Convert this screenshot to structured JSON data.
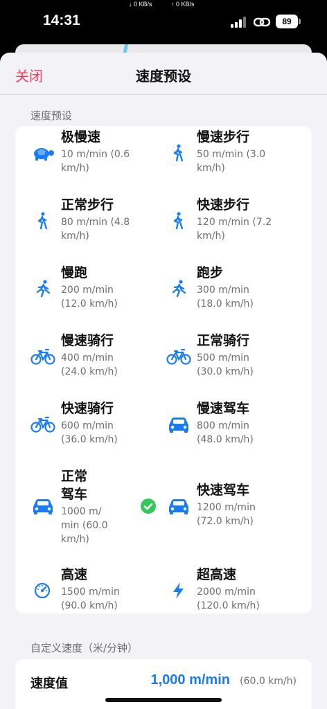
{
  "status": {
    "time": "14:31",
    "net_down": "↓ 0 KB/s",
    "net_up": "↑ 0 KB/s",
    "battery": "89"
  },
  "nav": {
    "close_label": "关闭",
    "title": "速度预设"
  },
  "presets_section": {
    "label": "速度预设",
    "items": [
      {
        "name": "极慢速",
        "line1": "10 m/min (0.6",
        "line2": "km/h)",
        "icon": "turtle-icon"
      },
      {
        "name": "慢速步行",
        "line1": "50 m/min (3.0",
        "line2": "km/h)",
        "icon": "walk-icon"
      },
      {
        "name": "正常步行",
        "line1": "80 m/min (4.8",
        "line2": "km/h)",
        "icon": "walk-icon"
      },
      {
        "name": "快速步行",
        "line1": "120 m/min (7.2",
        "line2": "km/h)",
        "icon": "walk-icon"
      },
      {
        "name": "慢跑",
        "line1": "200 m/min",
        "line2": "(12.0 km/h)",
        "icon": "run-icon"
      },
      {
        "name": "跑步",
        "line1": "300 m/min",
        "line2": "(18.0 km/h)",
        "icon": "run-icon"
      },
      {
        "name": "慢速骑行",
        "line1": "400 m/min",
        "line2": "(24.0 km/h)",
        "icon": "bicycle-icon"
      },
      {
        "name": "正常骑行",
        "line1": "500 m/min",
        "line2": "(30.0 km/h)",
        "icon": "bicycle-icon"
      },
      {
        "name": "快速骑行",
        "line1": "600 m/min",
        "line2": "(36.0 km/h)",
        "icon": "bicycle-icon"
      },
      {
        "name": "慢速驾车",
        "line1": "800 m/min",
        "line2": "(48.0 km/h)",
        "icon": "car-icon"
      },
      {
        "name_l1": "正常",
        "name_l2": "驾车",
        "line1": "1000 m/",
        "line2": "min (60.0",
        "line3": "km/h)",
        "icon": "car-icon",
        "selected": true
      },
      {
        "name": "快速驾车",
        "line1": "1200 m/min",
        "line2": "(72.0 km/h)",
        "icon": "car-icon"
      },
      {
        "name": "高速",
        "line1": "1500 m/min",
        "line2": "(90.0 km/h)",
        "icon": "speedometer-icon"
      },
      {
        "name": "超高速",
        "line1": "2000 m/min",
        "line2": "(120.0 km/h)",
        "icon": "bolt-icon"
      }
    ]
  },
  "custom_section": {
    "label": "自定义速度（米/分钟）",
    "speed_label": "速度值",
    "speed_value": "1,000 m/min",
    "speed_kmh": "(60.0 km/h)"
  },
  "colors": {
    "accent": "#1a7cf5",
    "close": "#ff3b5c",
    "selected": "#34c759"
  }
}
